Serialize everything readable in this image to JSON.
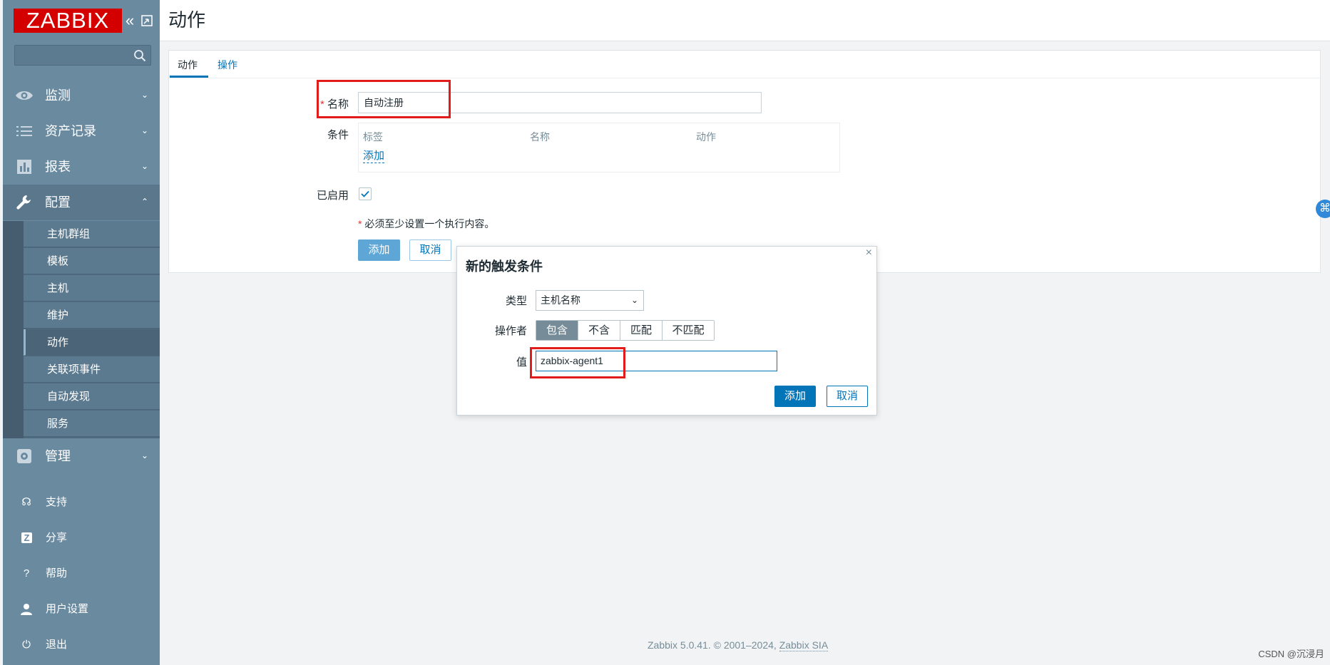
{
  "brand": {
    "logo_text": "ZABBIX",
    "color": "#d40000"
  },
  "sidebar": {
    "menu": [
      {
        "label": "监测",
        "icon": "eye-icon"
      },
      {
        "label": "资产记录",
        "icon": "list-icon"
      },
      {
        "label": "报表",
        "icon": "chart-icon"
      },
      {
        "label": "配置",
        "icon": "wrench-icon"
      },
      {
        "label": "管理",
        "icon": "gear-icon"
      }
    ],
    "config_submenu": [
      "主机群组",
      "模板",
      "主机",
      "维护",
      "动作",
      "关联项事件",
      "自动发现",
      "服务"
    ],
    "active_submenu": "动作",
    "footer": [
      {
        "label": "支持",
        "icon": "headset-icon"
      },
      {
        "label": "分享",
        "icon": "share-icon"
      },
      {
        "label": "帮助",
        "icon": "help-icon"
      },
      {
        "label": "用户设置",
        "icon": "user-icon"
      },
      {
        "label": "退出",
        "icon": "power-icon"
      }
    ]
  },
  "header": {
    "title": "动作"
  },
  "tabs": [
    "动作",
    "操作"
  ],
  "form": {
    "name_label": "名称",
    "name_value": "自动注册",
    "conditions_label": "条件",
    "conditions_columns": [
      "标签",
      "名称",
      "动作"
    ],
    "conditions_add": "添加",
    "enabled_label": "已启用",
    "enabled": true,
    "note": "必须至少设置一个执行内容。",
    "add_button": "添加",
    "cancel_button": "取消"
  },
  "dialog": {
    "title": "新的触发条件",
    "type_label": "类型",
    "type_value": "主机名称",
    "operator_label": "操作者",
    "operators": [
      "包含",
      "不含",
      "匹配",
      "不匹配"
    ],
    "operator_selected": "包含",
    "value_label": "值",
    "value": "zabbix-agent1",
    "add_button": "添加",
    "cancel_button": "取消"
  },
  "footer": {
    "text": "Zabbix 5.0.41. © 2001–2024, ",
    "link": "Zabbix SIA"
  },
  "watermark": "CSDN @沉浸月",
  "colors": {
    "accent": "#0275b8",
    "sidebar": "#6a8aa0",
    "highlight": "#e21b1b"
  }
}
